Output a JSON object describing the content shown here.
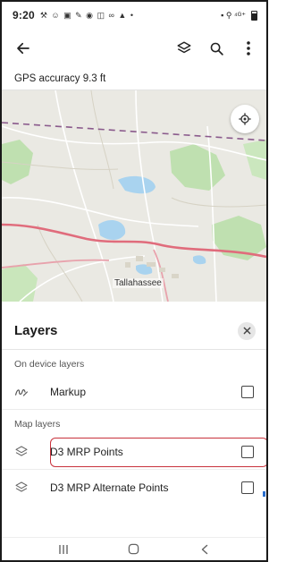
{
  "status_bar": {
    "time": "9:20",
    "notification_icons": "⚒ ☺ ▣ ✎ ◉ ◫ ∞ ▲ •",
    "system_icons": "▪ ⚲ ⁴ᴳ⁺"
  },
  "app_bar": {
    "back_icon": "arrow-left",
    "actions": [
      "layers-icon",
      "search-icon",
      "more-vertical-icon"
    ]
  },
  "gps": {
    "text": "GPS accuracy 9.3 ft"
  },
  "map": {
    "city_label": "Tallahassee",
    "colors": {
      "land": "#eae9e3",
      "forest": "#bfe0b0",
      "water": "#a9d3ef",
      "highway": "#e06c7c",
      "boundary": "#8a5a8c"
    }
  },
  "layers_panel": {
    "title": "Layers",
    "sections": [
      {
        "label": "On device layers",
        "items": [
          {
            "label": "Markup",
            "icon": "markup-icon",
            "checked": false
          }
        ]
      },
      {
        "label": "Map layers",
        "items": [
          {
            "label": "D3 MRP Points",
            "icon": "layers-stack-icon",
            "checked": false,
            "highlighted": true
          },
          {
            "label": "D3 MRP Alternate Points",
            "icon": "layers-stack-icon",
            "checked": false
          }
        ]
      }
    ],
    "highlight_color": "#c8323c"
  },
  "nav_bar": {
    "buttons": [
      "recents-icon",
      "home-icon",
      "back-nav-icon"
    ]
  }
}
